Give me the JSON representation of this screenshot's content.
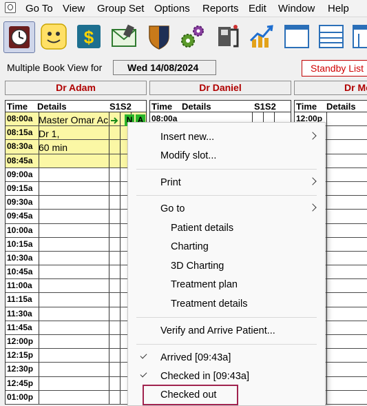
{
  "menubar": {
    "items": [
      "Go To",
      "View",
      "Group Set",
      "Options",
      "Reports",
      "Edit",
      "Window",
      "Help"
    ]
  },
  "toolbar": {
    "buttons": [
      "clock-icon",
      "smiley-icon",
      "dollar-icon",
      "envelope-icon",
      "shield-icon",
      "gears-icon",
      "xray-icon",
      "chart-icon",
      "window-icon",
      "list-icon",
      "window-split-icon"
    ]
  },
  "bookbar": {
    "label": "Multiple Book View for",
    "date": "Wed 14/08/2024",
    "standby": "Standby List"
  },
  "columns": [
    {
      "doctor": "Dr Adam"
    },
    {
      "doctor": "Dr Daniel"
    },
    {
      "doctor": "Dr Mo"
    }
  ],
  "grid_headers": {
    "time": "Time",
    "details": "Details",
    "s1s2": "S1S2"
  },
  "appointment": {
    "line1": "Master Omar Ac",
    "line2": "Dr 1,",
    "line3": "60 min",
    "badge_n": "N",
    "badge_a": "A"
  },
  "times": [
    "08:00a",
    "08:15a",
    "08:30a",
    "08:45a",
    "09:00a",
    "09:15a",
    "09:30a",
    "09:45a",
    "10:00a",
    "10:15a",
    "10:30a",
    "10:45a",
    "11:00a",
    "11:15a",
    "11:30a",
    "11:45a",
    "12:00p",
    "12:15p",
    "12:30p",
    "12:45p",
    "01:00p"
  ],
  "daniel_first_time": "08:00a",
  "mo_first_time": "12:00p",
  "context_menu": {
    "insert_new": "Insert new...",
    "modify_slot": "Modify slot...",
    "print": "Print",
    "go_to": "Go to",
    "patient_details": "Patient details",
    "charting": "Charting",
    "charting_3d": "3D Charting",
    "treatment_plan": "Treatment plan",
    "treatment_details": "Treatment details",
    "verify_arrive": "Verify and Arrive Patient...",
    "arrived": "Arrived [09:43a]",
    "checked_in": "Checked in [09:43a]",
    "checked_out": "Checked out"
  },
  "colors": {
    "doctor_header": "#b00000",
    "appointment_bg": "#fbf7a5",
    "highlight_border": "#a0224e",
    "badge_green": "#1fc21f"
  }
}
